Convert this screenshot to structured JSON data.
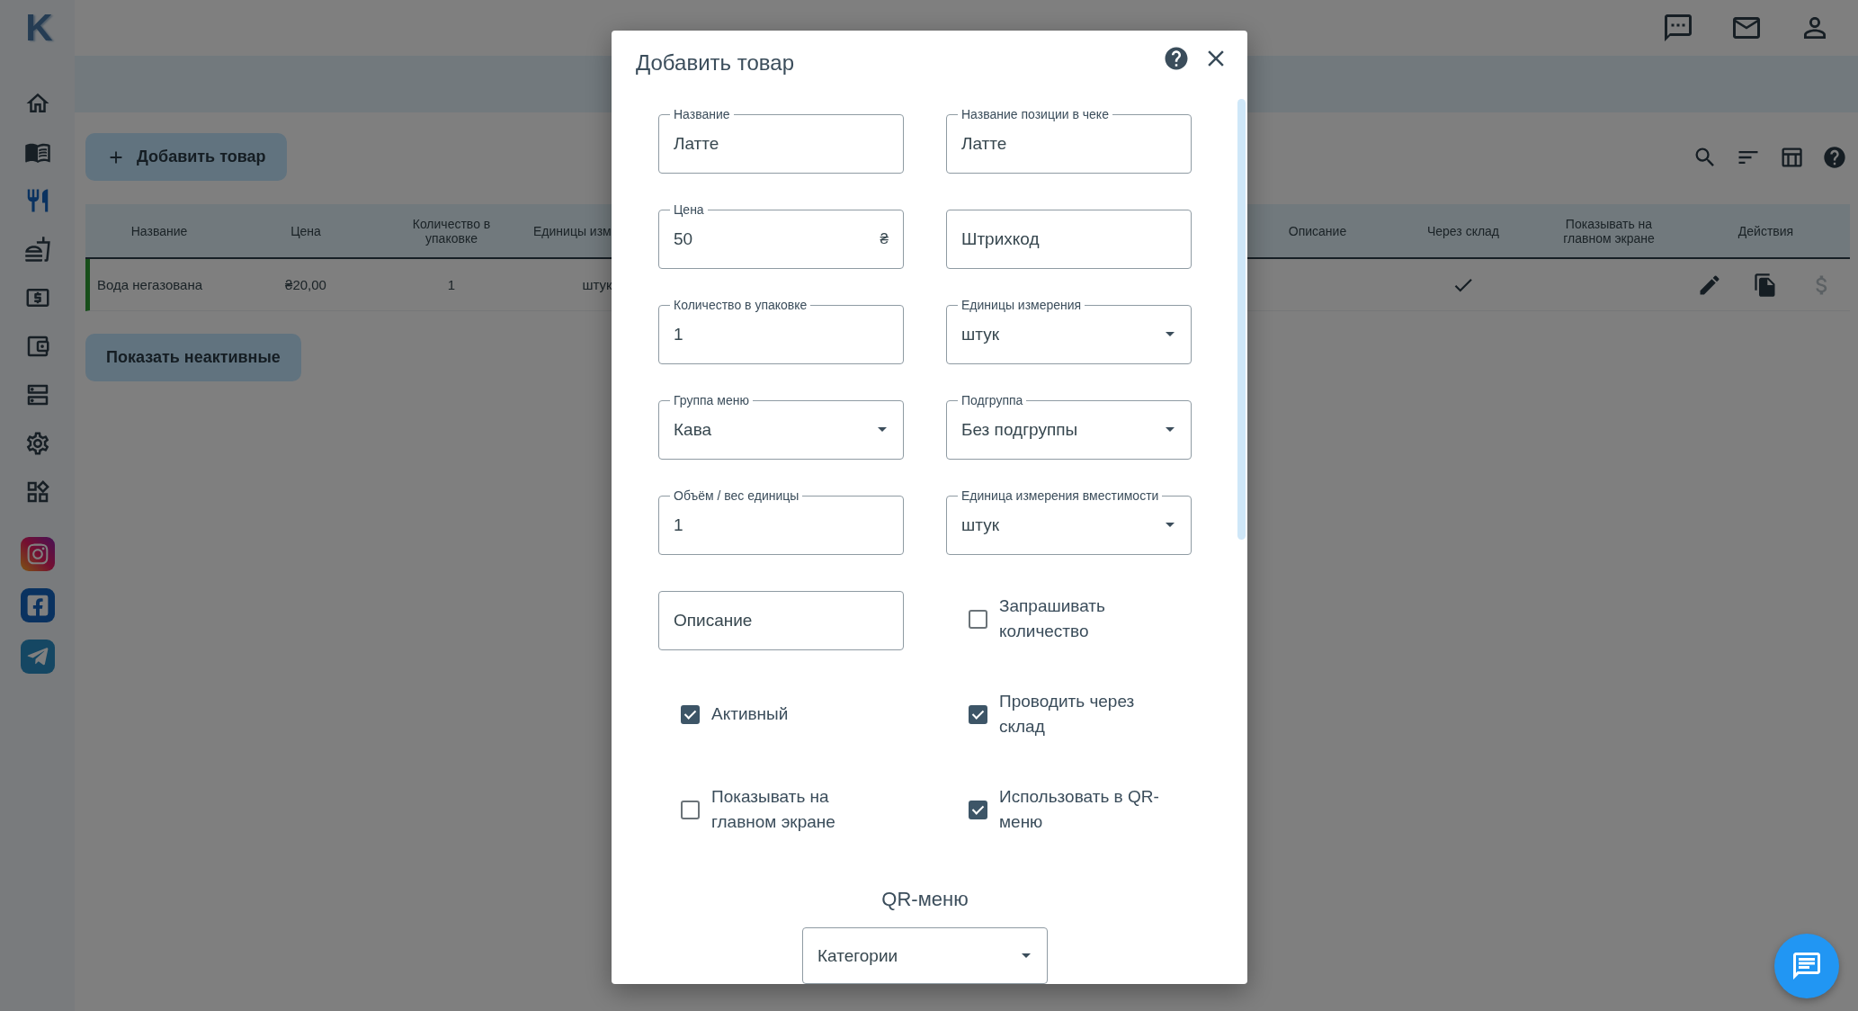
{
  "logo": "K",
  "sidebar": {
    "items": [
      {
        "selected": false
      },
      {
        "selected": false
      },
      {
        "selected": true
      },
      {
        "selected": false
      },
      {
        "selected": false
      },
      {
        "selected": false
      },
      {
        "selected": false
      },
      {
        "selected": false
      },
      {
        "selected": false
      }
    ]
  },
  "add_button": "Добавить товар",
  "table": {
    "columns": [
      "Название",
      "Цена",
      "Количество в упаковке",
      "Единицы изм",
      "Описание",
      "Через склад",
      "Показывать на главном экране",
      "Действия"
    ],
    "rows": [
      {
        "active": true,
        "cells": [
          "Вода негазована",
          "₴20,00",
          "1",
          "штук"
        ],
        "warehouse": true,
        "actions": [
          {
            "kind": "edit",
            "disabled": false
          },
          {
            "kind": "copy",
            "disabled": false
          },
          {
            "kind": "price",
            "disabled": true
          }
        ]
      }
    ]
  },
  "show_inactive_button": "Показать неактивные",
  "dialog": {
    "title": "Добавить товар",
    "fields": [
      {
        "kind": "input",
        "label": "Название",
        "value": "Латте"
      },
      {
        "kind": "input",
        "label": "Название позиции в чеке",
        "value": "Латте"
      },
      {
        "kind": "input",
        "label": "Цена",
        "value": "50",
        "suffix": "₴"
      },
      {
        "kind": "input",
        "placeholder": "Штрихкод"
      },
      {
        "kind": "input",
        "label": "Количество в упаковке",
        "value": "1"
      },
      {
        "kind": "select",
        "label": "Единицы измерения",
        "value": "штук"
      },
      {
        "kind": "select",
        "label": "Группа меню",
        "value": "Кава"
      },
      {
        "kind": "select",
        "label": "Подгруппа",
        "value": "Без подгруппы"
      },
      {
        "kind": "input",
        "label": "Объём / вес единицы",
        "value": "1"
      },
      {
        "kind": "select",
        "label": "Единица измерения вместимости",
        "value": "штук"
      },
      {
        "kind": "input",
        "placeholder": "Описание"
      },
      {
        "kind": "checkbox",
        "label": "Запрашивать количество",
        "checked": false
      },
      {
        "kind": "checkbox",
        "label": "Активный",
        "checked": true
      },
      {
        "kind": "checkbox",
        "label": "Проводить через склад",
        "checked": true
      },
      {
        "kind": "checkbox",
        "label": "Показывать на главном экране",
        "checked": false
      },
      {
        "kind": "checkbox",
        "label": "Использовать в QR-меню",
        "checked": true
      }
    ],
    "qr_section": {
      "title": "QR-меню",
      "select": {
        "value": "Категории"
      }
    }
  }
}
